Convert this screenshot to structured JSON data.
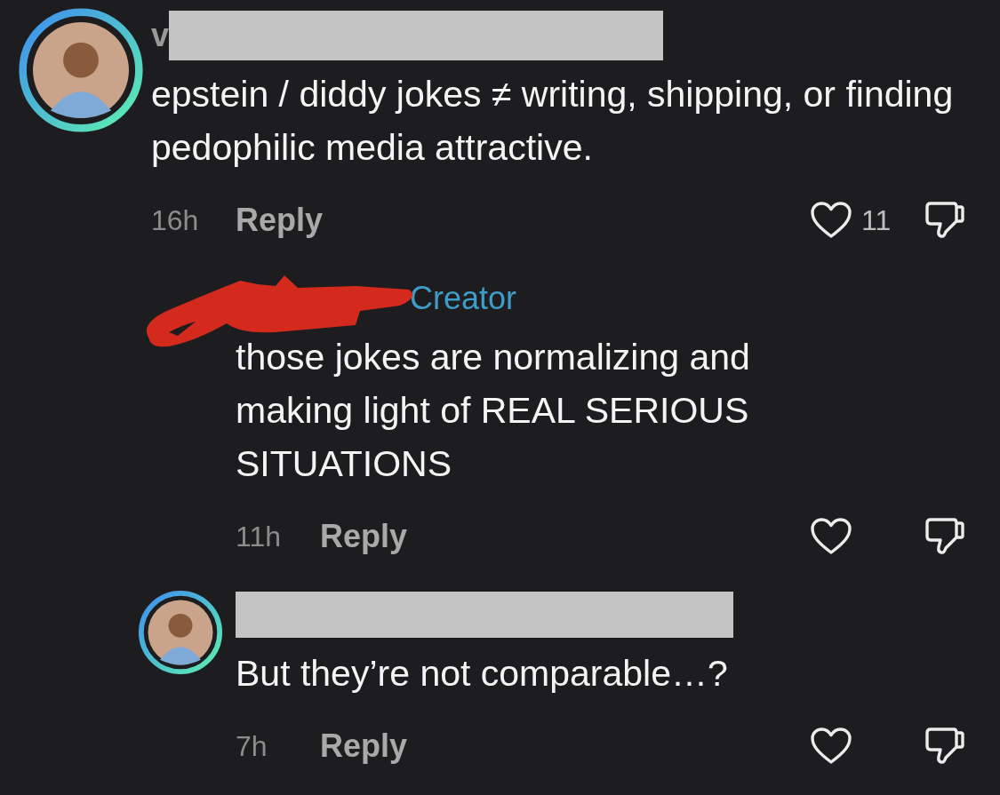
{
  "comments": [
    {
      "kind": "comment",
      "name_start": "v",
      "redaction": {
        "kind": "bar"
      },
      "text": "epstein / diddy jokes ≠ writing, shipping, or finding pedophilic media attractive.",
      "time": "16h",
      "reply_label": "Reply",
      "like_count": "11"
    },
    {
      "kind": "reply",
      "redaction": {
        "kind": "scribble"
      },
      "badge": "Creator",
      "text": "those jokes are normalizing and making light of REAL SERIOUS SITUATIONS",
      "time": "11h",
      "reply_label": "Reply"
    },
    {
      "kind": "reply",
      "redaction": {
        "kind": "bar"
      },
      "text": "But they’re not comparable…?",
      "time": "7h",
      "reply_label": "Reply"
    }
  ]
}
